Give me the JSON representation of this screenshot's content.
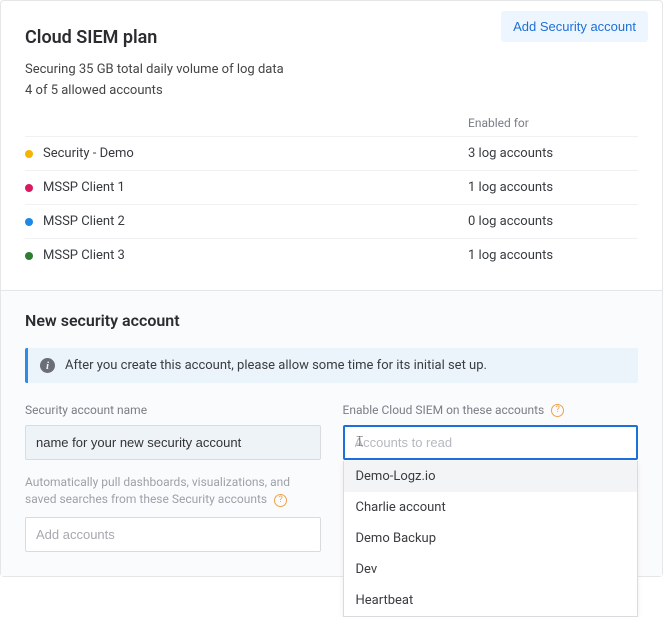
{
  "header": {
    "title": "Cloud SIEM plan",
    "add_button": "Add Security account",
    "securing_line": "Securing 35 GB total daily volume of log data",
    "accounts_line": "4 of 5 allowed accounts"
  },
  "table": {
    "enabled_header": "Enabled for",
    "rows": [
      {
        "color": "#f5b400",
        "name": "Security - Demo",
        "enabled": "3 log accounts"
      },
      {
        "color": "#d81b60",
        "name": "MSSP Client 1",
        "enabled": "1 log accounts"
      },
      {
        "color": "#1e88e5",
        "name": "MSSP Client 2",
        "enabled": "0 log accounts"
      },
      {
        "color": "#2e7d32",
        "name": "MSSP Client 3",
        "enabled": "1 log accounts"
      }
    ]
  },
  "new_account": {
    "title": "New security account",
    "info": "After you create this account, please allow some time for its initial set up.",
    "name_label": "Security account name",
    "name_value": "name for your new security account",
    "enable_label": "Enable Cloud SIEM on these accounts",
    "enable_placeholder": "Accounts to read",
    "auto_label": "Automatically pull dashboards, visualizations, and saved searches from these Security accounts",
    "auto_placeholder": "Add accounts",
    "dropdown": [
      "Demo-Logz.io",
      "Charlie account",
      "Demo Backup",
      "Dev",
      "Heartbeat"
    ]
  }
}
